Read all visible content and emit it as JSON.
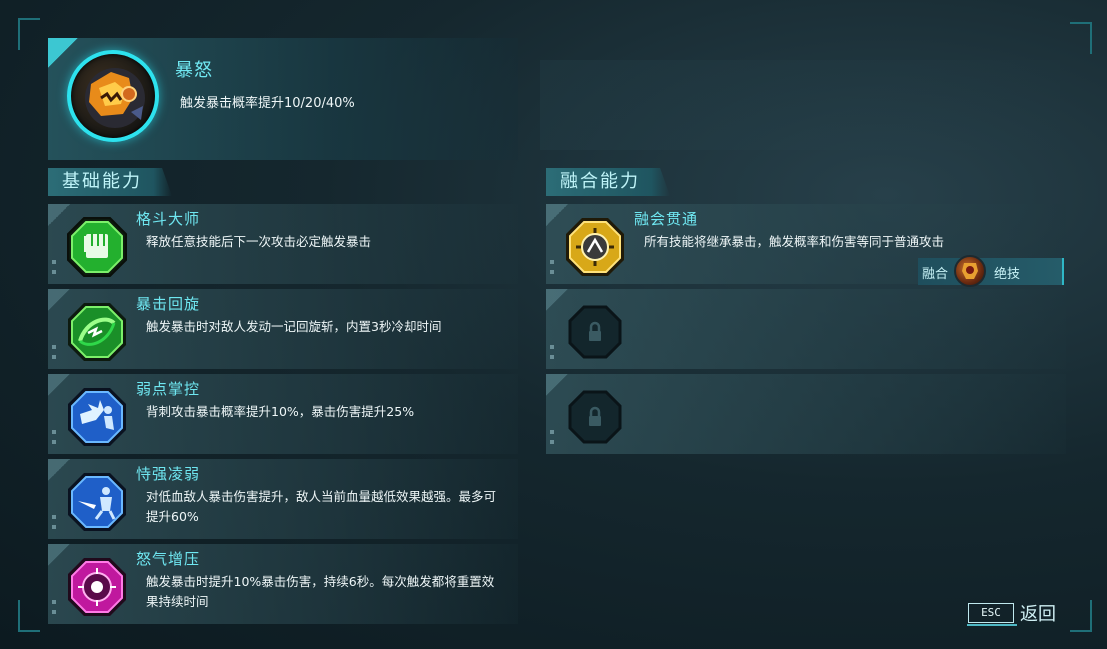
{
  "hero": {
    "name": "暴怒",
    "description": "触发暴击概率提升10/20/40%",
    "icon": "rage-beast-icon"
  },
  "sections": {
    "basic_title": "基础能力",
    "fusion_title": "融合能力"
  },
  "basic_skills": [
    {
      "name": "格斗大师",
      "description": "释放任意技能后下一次攻击必定触发暴击",
      "icon": "fist-icon",
      "color": "#2fc43a"
    },
    {
      "name": "暴击回旋",
      "description": "触发暴击时对敌人发动一记回旋斩，内置3秒冷却时间",
      "icon": "spin-slash-icon",
      "color": "#2fc43a"
    },
    {
      "name": "弱点掌控",
      "description": "背刺攻击暴击概率提升10%，暴击伤害提升25%",
      "icon": "weak-point-icon",
      "color": "#2a7fe0"
    },
    {
      "name": "恃强凌弱",
      "description": "对低血敌人暴击伤害提升，敌人当前血量越低效果越强。最多可提升60%",
      "icon": "blade-strike-icon",
      "color": "#2a7fe0"
    },
    {
      "name": "怒气增压",
      "description": "触发暴击时提升10%暴击伤害，持续6秒。每次触发都将重置效果持续时间",
      "icon": "rage-pressure-icon",
      "color": "#e02ab8"
    }
  ],
  "fusion_skills": [
    {
      "name": "融会贯通",
      "description": "所有技能将继承暴击，触发概率和伤害等同于普通攻击",
      "icon": "fusion-compass-icon",
      "color": "#e8b820"
    },
    {
      "name": "",
      "description": "",
      "icon": "lock-icon",
      "locked": true
    },
    {
      "name": "",
      "description": "",
      "icon": "lock-icon",
      "locked": true
    }
  ],
  "fusion_tag": {
    "left_label": "融合",
    "right_label": "绝技",
    "icon": "ultimate-badge-icon"
  },
  "footer": {
    "esc_key": "ESC",
    "back_label": "返回"
  }
}
